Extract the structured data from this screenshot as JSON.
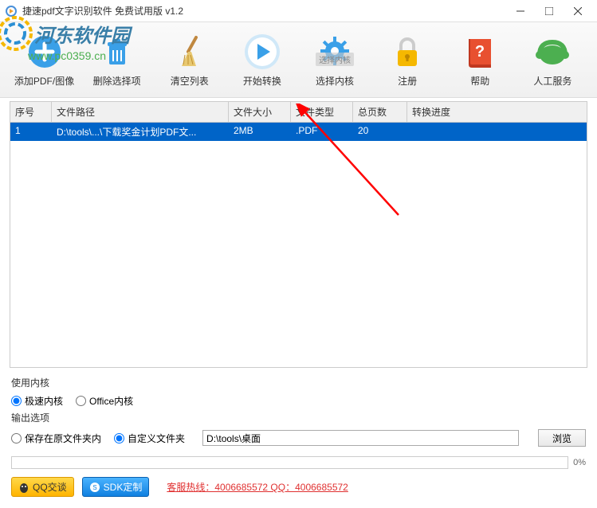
{
  "titlebar": {
    "title": "捷速pdf文字识别软件 免费试用版 v1.2"
  },
  "watermark": {
    "text": "河东软件园",
    "url": "www.pc0359.cn"
  },
  "toolbar": {
    "items": [
      {
        "label": "添加PDF/图像"
      },
      {
        "label": "删除选择项"
      },
      {
        "label": "清空列表"
      },
      {
        "label": "开始转换"
      },
      {
        "label": "选择内核",
        "sublabel": "选择内核"
      },
      {
        "label": "注册"
      },
      {
        "label": "帮助"
      },
      {
        "label": "人工服务"
      }
    ]
  },
  "table": {
    "headers": [
      "序号",
      "文件路径",
      "文件大小",
      "文件类型",
      "总页数",
      "转换进度"
    ],
    "rows": [
      {
        "index": "1",
        "path": "D:\\tools\\...\\下载奖金计划PDF文...",
        "size": "2MB",
        "type": ".PDF",
        "pages": "20",
        "progress": ""
      }
    ]
  },
  "settings": {
    "kernel_title": "使用内核",
    "kernel_fast": "极速内核",
    "kernel_office": "Office内核",
    "output_title": "输出选项",
    "output_same": "保存在原文件夹内",
    "output_custom": "自定义文件夹",
    "output_path": "D:\\tools\\桌面",
    "browse": "浏览"
  },
  "progress": {
    "percent": "0%"
  },
  "bottom": {
    "qq": "QQ交谈",
    "sdk": "SDK定制",
    "hotline": "客服热线：4006685572 QQ：4006685572"
  }
}
